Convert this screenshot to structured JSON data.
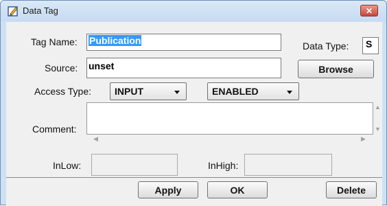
{
  "window": {
    "title": "Data Tag",
    "close_glyph": "✕"
  },
  "form": {
    "tag_name_label": "Tag Name:",
    "tag_name_value": "Publication",
    "data_type_label": "Data Type:",
    "data_type_value": "S",
    "source_label": "Source:",
    "source_value": "unset",
    "browse_label": "Browse",
    "access_type_label": "Access Type:",
    "access_type_value": "INPUT",
    "enabled_value": "ENABLED",
    "comment_label": "Comment:",
    "comment_value": "",
    "inlow_label": "InLow:",
    "inlow_value": "",
    "inhigh_label": "InHigh:",
    "inhigh_value": ""
  },
  "buttons": {
    "apply": "Apply",
    "ok": "OK",
    "delete": "Delete"
  },
  "scroll": {
    "up": "▲",
    "down": "▼",
    "left": "◀",
    "right": "▶"
  },
  "icons": {
    "app": "edit-tag-icon",
    "close": "close-icon"
  }
}
